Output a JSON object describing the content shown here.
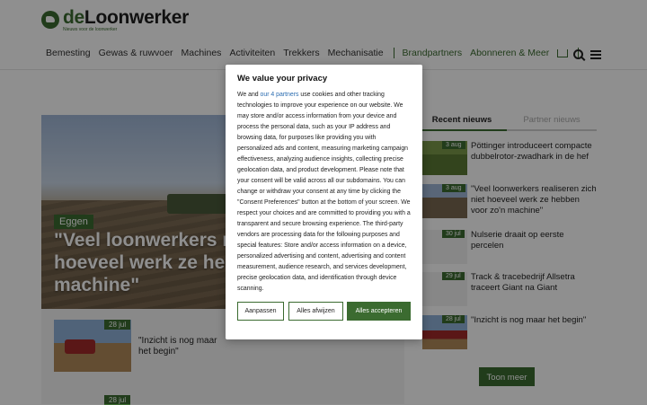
{
  "header": {
    "logo": {
      "name_prefix": "de",
      "name_rest": "Loonwerker",
      "tagline": "Nieuws voor de loonwerker"
    },
    "nav": [
      "Bemesting",
      "Gewas & ruwvoer",
      "Machines",
      "Activiteiten",
      "Trekkers",
      "Mechanisatie"
    ],
    "nav_green": [
      "Brandpartners",
      "Abonneren & Meer"
    ]
  },
  "hero": {
    "tag": "Eggen",
    "title": "\"Veel loonwerkers realiseren zich niet hoeveel werk ze hebben voor zo'n machine\""
  },
  "main_list": [
    {
      "date": "28 jul",
      "title": "\"Inzicht is nog maar het begin\""
    },
    {
      "date": "28 jul"
    }
  ],
  "sidebar": {
    "tabs": [
      "Recent nieuws",
      "Partner nieuws"
    ],
    "news": [
      {
        "date": "3 aug",
        "title": "Pöttinger introduceert compacte dubbelrotor-zwadhark in de hef"
      },
      {
        "date": "3 aug",
        "title": "\"Veel loonwerkers realiseren zich niet hoeveel werk ze hebben voor zo'n machine\""
      },
      {
        "date": "30 jul",
        "title": "Nulserie draait op eerste percelen"
      },
      {
        "date": "29 jul",
        "title": "Track & tracebedrijf Allsetra traceert Giant na Giant"
      },
      {
        "date": "28 jul",
        "title": "\"Inzicht is nog maar het begin\""
      }
    ],
    "more_label": "Toon meer"
  },
  "consent": {
    "title": "We value your privacy",
    "text_before_link": "We and ",
    "link_text": "our 4 partners",
    "text_after_link": " use cookies and other tracking technologies to improve your experience on our website. We may store and/or access information from your device and process the personal data, such as your IP address and browsing data, for purposes like providing you with personalized ads and content, measuring marketing campaign effectiveness, analyzing audience insights, collecting precise geolocation data, and product development. Please note that your consent will be valid across all our subdomains. You can change or withdraw your consent at any time by clicking the \"Consent Preferences\" button at the bottom of your screen. We respect your choices and are committed to providing you with a transparent and secure browsing experience. The third-party vendors are processing data for the following purposes and special features: Store and/or access information on a device, personalized advertising and content, advertising and content measurement, audience research, and services development, precise geolocation data, and identification through device scanning.",
    "buttons": {
      "customize": "Aanpassen",
      "reject": "Alles afwijzen",
      "accept": "Alles accepteren"
    }
  },
  "colors": {
    "brand_green": "#3b6b30",
    "link_blue": "#2b6cb0"
  },
  "icons": [
    "tractor-logo-icon",
    "cart-icon",
    "search-icon",
    "menu-icon"
  ]
}
